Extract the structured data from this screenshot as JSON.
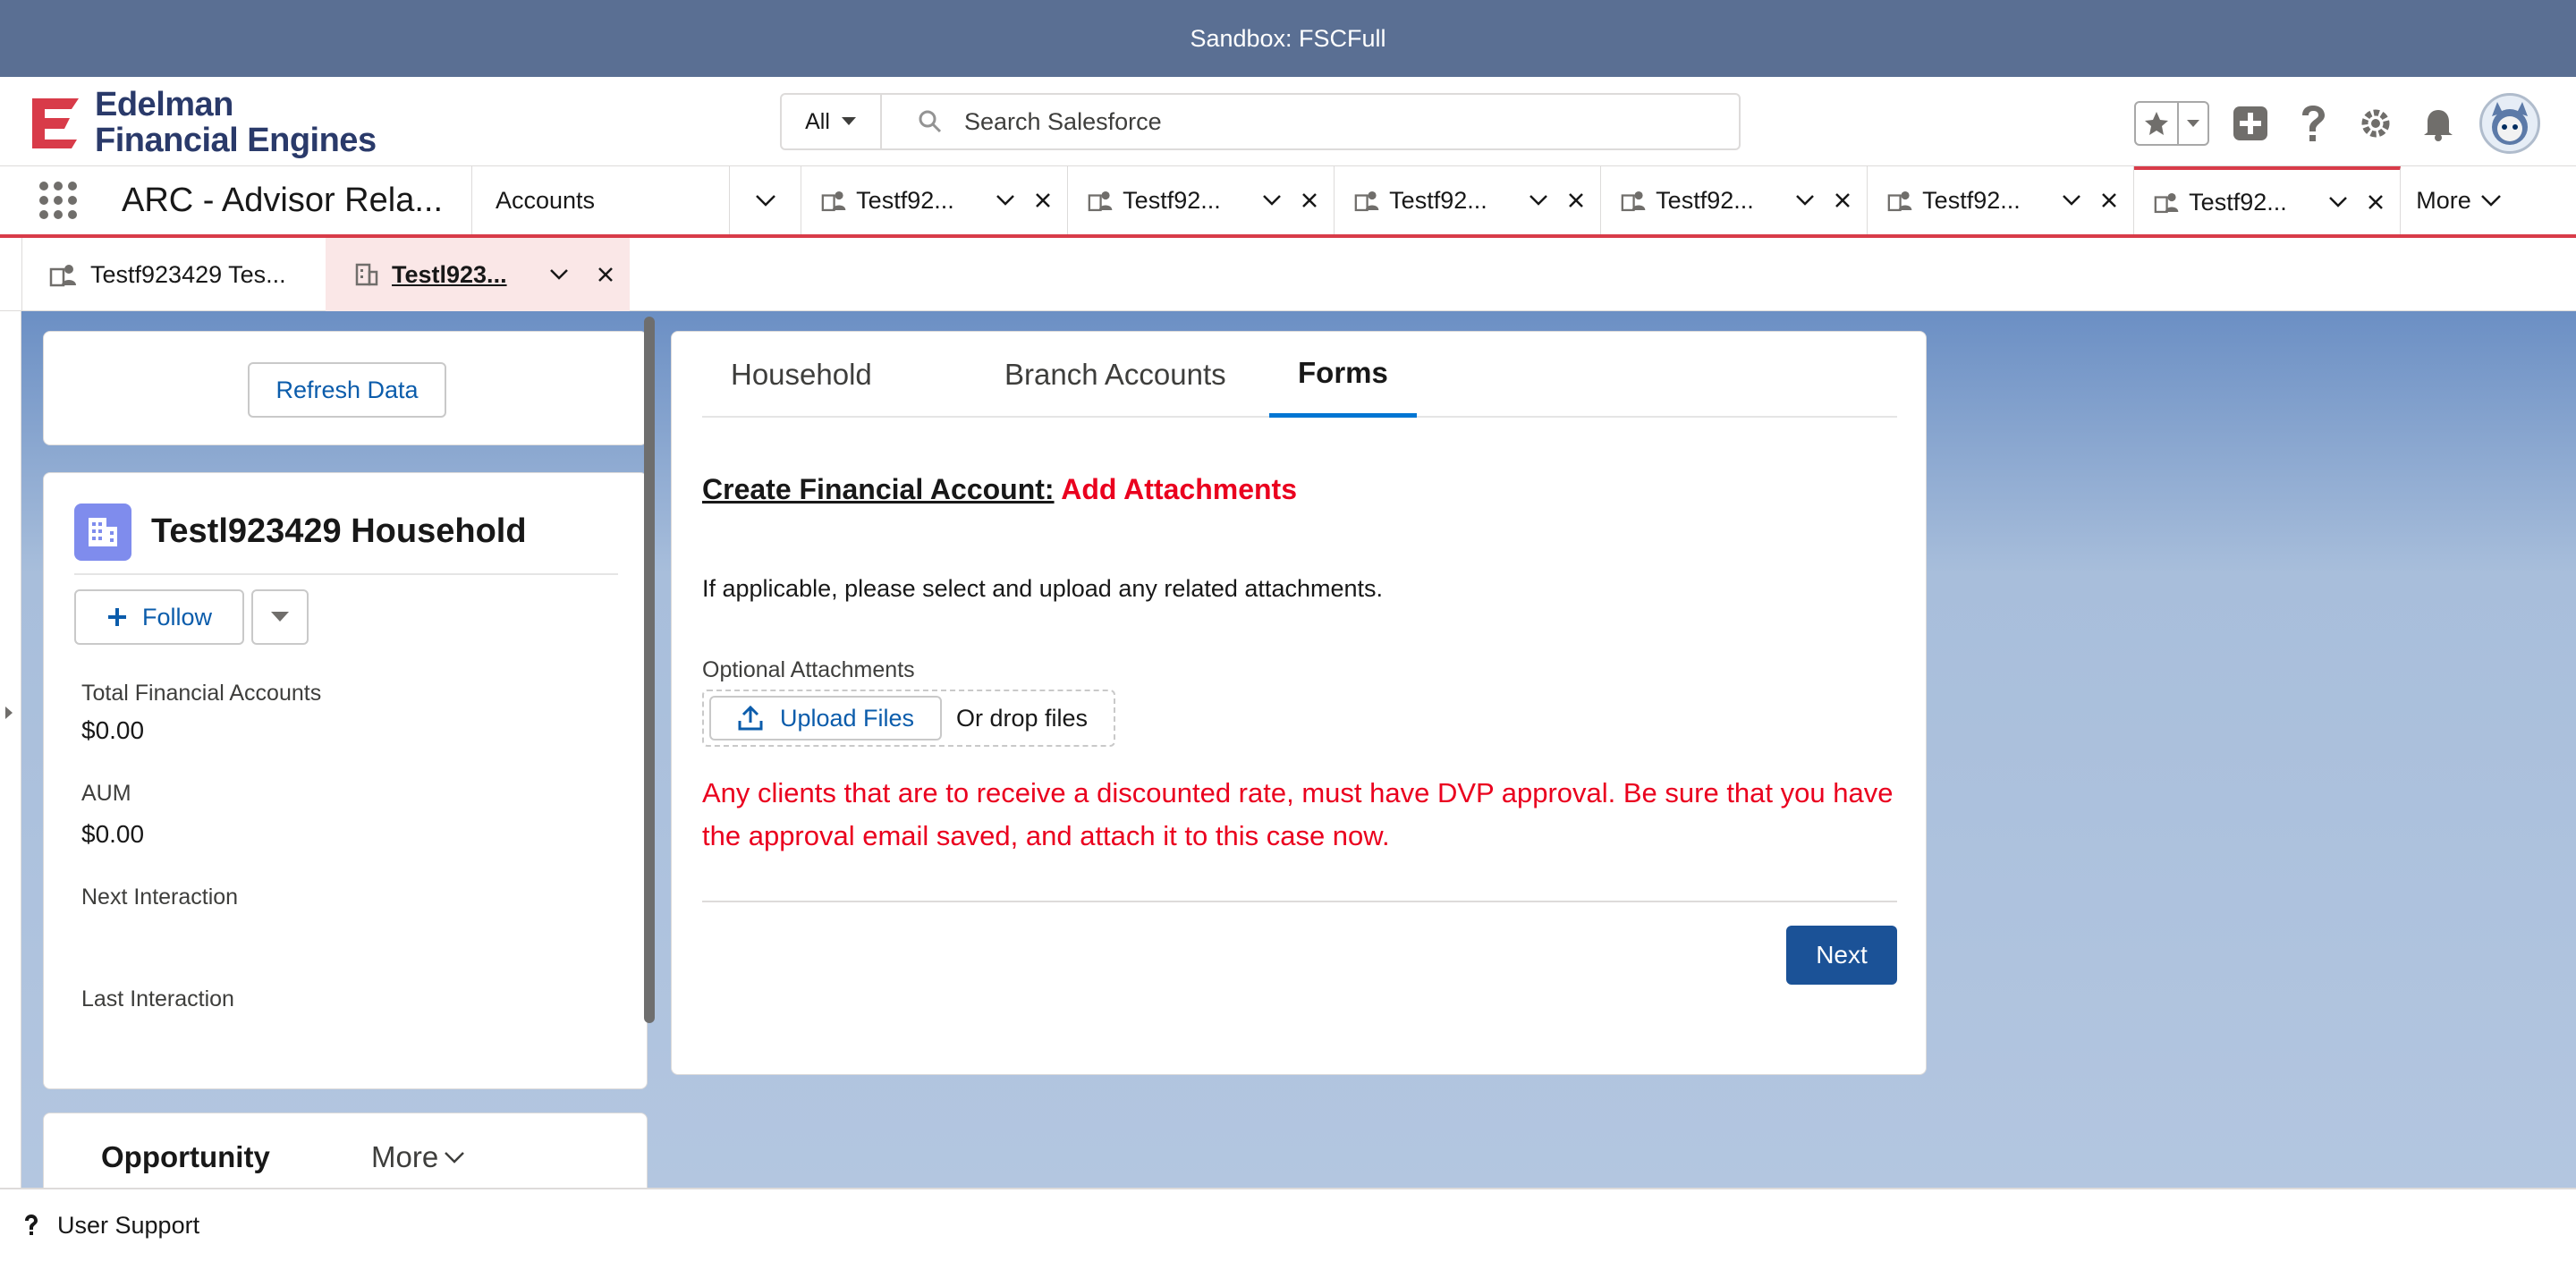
{
  "sandbox": {
    "label": "Sandbox: FSCFull"
  },
  "brand": {
    "line1": "Edelman",
    "line2": "Financial Engines",
    "color": "#d83b49"
  },
  "search": {
    "scope": "All",
    "placeholder": "Search Salesforce"
  },
  "app": {
    "name": "ARC - Advisor Rela..."
  },
  "nav": {
    "accounts_label": "Accounts",
    "tabs": [
      {
        "label": "Testf92..."
      },
      {
        "label": "Testf92..."
      },
      {
        "label": "Testf92..."
      },
      {
        "label": "Testf92..."
      },
      {
        "label": "Testf92..."
      },
      {
        "label": "Testf92..."
      }
    ],
    "more_label": "More"
  },
  "subtabs": [
    {
      "label": "Testf923429 Tes..."
    },
    {
      "label": "Testl923..."
    }
  ],
  "refresh": {
    "label": "Refresh Data"
  },
  "household": {
    "title": "Testl923429 Household",
    "follow_label": "Follow",
    "fields": {
      "total_label": "Total Financial Accounts",
      "total_value": "$0.00",
      "aum_label": "AUM",
      "aum_value": "$0.00",
      "next_label": "Next Interaction",
      "last_label": "Last Interaction"
    }
  },
  "opportunity": {
    "title": "Opportunity",
    "more_label": "More"
  },
  "forms": {
    "tabs": [
      {
        "label": "Household"
      },
      {
        "label": "Branch Accounts"
      },
      {
        "label": "Forms"
      }
    ],
    "active_tab": "Forms",
    "title_part1": "Create Financial Account:",
    "title_part2": "Add Attachments",
    "help_text": "If applicable, please select and upload any related attachments.",
    "attachments_label": "Optional Attachments",
    "upload_label": "Upload Files",
    "drop_label": "Or drop files",
    "warning": "Any clients that are to receive a discounted rate, must have DVP approval. Be sure that you have the approval email saved, and attach it to this case now.",
    "next_label": "Next"
  },
  "utility": {
    "label": "User Support"
  },
  "colors": {
    "brand_button": "#1b5297",
    "warning": "#ea001e",
    "tab_accent": "#0176d3",
    "nav_accent": "#d83b49"
  }
}
